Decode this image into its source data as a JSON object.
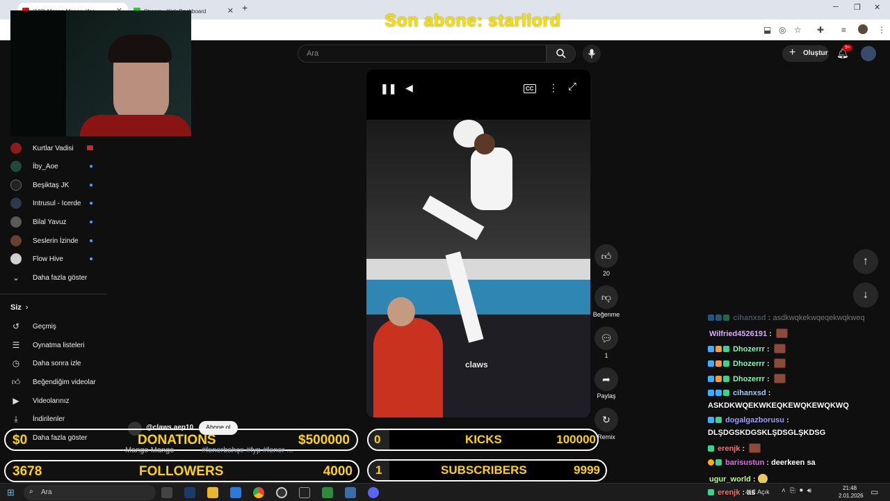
{
  "browser": {
    "tabs": [
      {
        "label": "(103) Mango Mango #fen",
        "active": true
      },
      {
        "label": "Stream - Kick Dashboard",
        "active": false
      }
    ],
    "new_tab": "+",
    "win_min": "─",
    "win_max": "❐",
    "win_close": "✕"
  },
  "overlay": {
    "last_sub": "Son abone: starllord"
  },
  "youtube": {
    "search_placeholder": "Ara",
    "create_label": "Oluştur",
    "notif_count": "9+"
  },
  "sidebar": {
    "subscriptions": [
      {
        "label": "Kurtlar Vadisi",
        "avatar_color": "#8a1c1c",
        "live": true
      },
      {
        "label": "İby_Aoe",
        "avatar_color": "#1f4a3a",
        "live": false
      },
      {
        "label": "Beşiktaş JK",
        "avatar_color": "#222222",
        "live": false
      },
      {
        "label": "Intrusul - Icerde",
        "avatar_color": "#2a3a4a",
        "live": false
      },
      {
        "label": "Bilal Yavuz",
        "avatar_color": "#5a5a5a",
        "live": false
      },
      {
        "label": "Seslerin İzinde",
        "avatar_color": "#6a4030",
        "live": false
      },
      {
        "label": "Flow Hive",
        "avatar_color": "#d0d0d0",
        "live": false
      }
    ],
    "show_more": "Daha fazla göster",
    "you_header": "Siz",
    "you_items": [
      {
        "label": "Geçmiş",
        "icon": "history-icon"
      },
      {
        "label": "Oynatma listeleri",
        "icon": "playlist-icon"
      },
      {
        "label": "Daha sonra izle",
        "icon": "clock-icon"
      },
      {
        "label": "Beğendiğim videolar",
        "icon": "thumb-up-icon"
      },
      {
        "label": "Videolarınız",
        "icon": "video-icon"
      },
      {
        "label": "İndirilenler",
        "icon": "download-icon"
      }
    ],
    "show_more_2": "Daha fazla göster"
  },
  "video": {
    "watermark": "claws",
    "channel": "@claws.aep10",
    "subscribe": "Abone ol",
    "title": "Mango Mango",
    "hashtags": "#fenerbahçe #fyp #fener ..."
  },
  "actions": {
    "likes": "20",
    "dislike_label": "Beğenme",
    "comments": "1",
    "share_label": "Paylaş",
    "remix_label": "Remix"
  },
  "chat": [
    {
      "user": "cihanxsd",
      "user_color": "#7fb0c0",
      "text": "asdkwqkekwqeqekwqkweq",
      "badges": [
        "#3bb0ff",
        "#3bb0ff",
        "#3bd18f"
      ],
      "faded": true
    },
    {
      "user": "Wilfried4526191",
      "user_color": "#e0b0ff",
      "text": "",
      "emote": true,
      "badges": []
    },
    {
      "user": "Dhozerrr",
      "user_color": "#7fffc0",
      "text": "",
      "emote": true,
      "badges": [
        "#3bb0ff",
        "#ff9933",
        "#3bd18f"
      ]
    },
    {
      "user": "Dhozerrr",
      "user_color": "#7fffc0",
      "text": "",
      "emote": true,
      "badges": [
        "#3bb0ff",
        "#ff9933",
        "#3bd18f"
      ]
    },
    {
      "user": "Dhozerrr",
      "user_color": "#7fffc0",
      "text": "",
      "emote": true,
      "badges": [
        "#3bb0ff",
        "#ff9933",
        "#3bd18f"
      ]
    },
    {
      "user": "cihanxsd",
      "user_color": "#a0d0ff",
      "text": "",
      "badges": [
        "#3bb0ff",
        "#3bb0ff",
        "#3bd18f"
      ]
    },
    {
      "user": "",
      "user_color": "#ffffff",
      "text": "ASKDKWQEKWKEQKEWQKEWQKWQ",
      "badges": []
    },
    {
      "user": "dogalgazborusu",
      "user_color": "#a0a0ff",
      "text": "",
      "badges": [
        "#3bb0ff",
        "#3bd18f"
      ]
    },
    {
      "user": "",
      "user_color": "#ffffff",
      "text": "DLŞDGSKDGSKLŞDSGLŞKDSG",
      "badges": []
    },
    {
      "user": "erenjk",
      "user_color": "#ff7070",
      "text": "",
      "emote": true,
      "badges": [
        "#3bd18f"
      ]
    },
    {
      "user": "barisustun",
      "user_color": "#e070e0",
      "text": "deerkeen sa",
      "badges": [
        "#ffb000",
        "#3bd18f"
      ]
    },
    {
      "user": "ugur_world",
      "user_color": "#c0ff80",
      "text": "",
      "smile": true,
      "badges": []
    },
    {
      "user": "erenjk",
      "user_color": "#ff7070",
      "text": "as",
      "badges": [
        "#3bd18f"
      ]
    }
  ],
  "stats": {
    "donations": {
      "current": "$0",
      "label": "DONATIONS",
      "goal": "$500000"
    },
    "kicks": {
      "current": "0",
      "label": "KICKS",
      "goal": "100000"
    },
    "followers": {
      "current": "3678",
      "label": "FOLLOWERS",
      "goal": "4000"
    },
    "subscribers": {
      "current": "1",
      "label": "SUBSCRIBERS",
      "goal": "9999"
    }
  },
  "taskbar": {
    "search": "Ara",
    "weather": "4°C Açık",
    "time": "21:48",
    "date": "2.01.2026"
  }
}
